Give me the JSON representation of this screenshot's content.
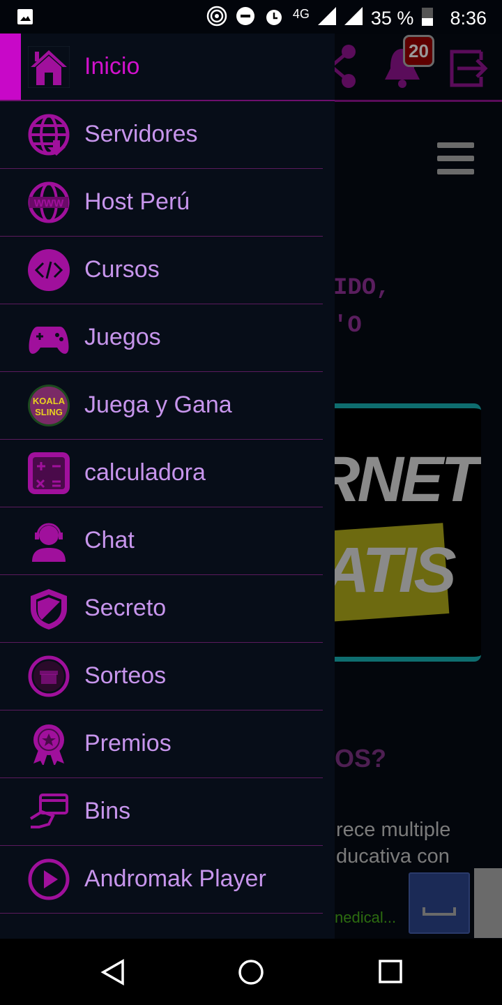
{
  "status_bar": {
    "battery": "35 %",
    "time": "8:36",
    "network": "4G"
  },
  "app_bar": {
    "notification_count": "20"
  },
  "background": {
    "heading_fragment_1": "IDO,",
    "heading_fragment_2": "'O",
    "banner_text_1": "RNET",
    "banner_text_2": "ATIS",
    "question_fragment": "OS?",
    "paragraph_line_1": "rece multiple",
    "paragraph_line_2": "ducativa con",
    "ad_link": "nedical..."
  },
  "drawer": {
    "items": [
      {
        "label": "Inicio",
        "icon": "home-icon",
        "active": true
      },
      {
        "label": "Servidores",
        "icon": "globe-download-icon"
      },
      {
        "label": "Host Perú",
        "icon": "globe-www-icon"
      },
      {
        "label": "Cursos",
        "icon": "code-icon"
      },
      {
        "label": "Juegos",
        "icon": "gamepad-icon"
      },
      {
        "label": "Juega y Gana",
        "icon": "koala-sling-icon",
        "icon_text": "KOALA SLING"
      },
      {
        "label": "calculadora",
        "icon": "calculator-icon"
      },
      {
        "label": "Chat",
        "icon": "support-agent-icon"
      },
      {
        "label": "Secreto",
        "icon": "shield-icon"
      },
      {
        "label": "Sorteos",
        "icon": "gift-icon"
      },
      {
        "label": "Premios",
        "icon": "award-icon"
      },
      {
        "label": "Bins",
        "icon": "card-icon"
      },
      {
        "label": "Andromak Player",
        "icon": "play-icon"
      }
    ]
  },
  "colors": {
    "accent": "#c808c8",
    "icon": "#a0109c",
    "label": "#c795ec",
    "drawer_bg": "#070d18"
  }
}
